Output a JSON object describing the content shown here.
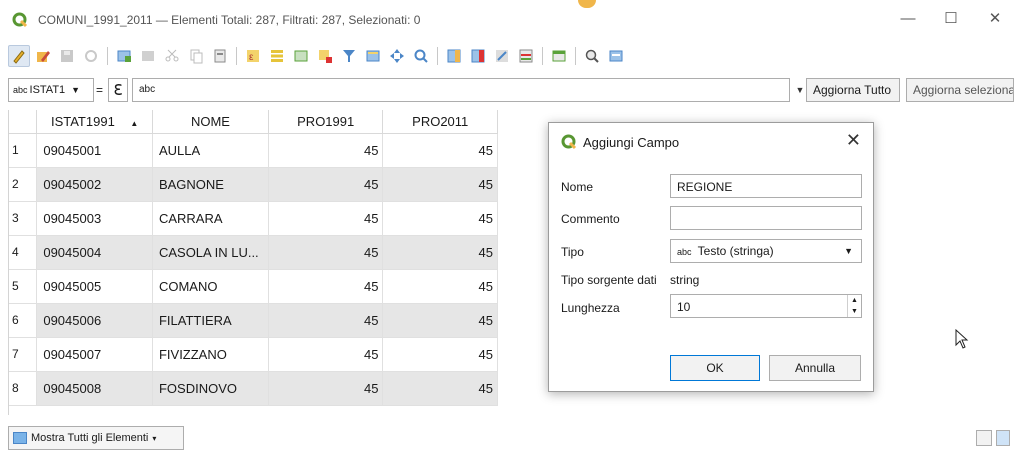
{
  "window": {
    "title": "COMUNI_1991_2011 — Elementi Totali: 287, Filtrati: 287, Selezionati: 0",
    "minimize": "—",
    "maximize": "☐",
    "close": "✕"
  },
  "filter": {
    "field_prefix": "abc",
    "field_name": "ISTAT1",
    "operator": "=",
    "expression_symbol": "ℇ",
    "value": "abc",
    "refresh_label": "Aggiorna Tutto",
    "update_selection_label": "Aggiorna selezionati"
  },
  "table": {
    "columns": [
      "ISTAT1991",
      "NOME",
      "PRO1991",
      "PRO2011"
    ],
    "sort_indicator": "▲",
    "rows": [
      {
        "id": "1",
        "istat": "09045001",
        "nome": "AULLA",
        "pro1991": "45",
        "pro2011": "45"
      },
      {
        "id": "2",
        "istat": "09045002",
        "nome": "BAGNONE",
        "pro1991": "45",
        "pro2011": "45"
      },
      {
        "id": "3",
        "istat": "09045003",
        "nome": "CARRARA",
        "pro1991": "45",
        "pro2011": "45"
      },
      {
        "id": "4",
        "istat": "09045004",
        "nome": "CASOLA IN LU...",
        "pro1991": "45",
        "pro2011": "45"
      },
      {
        "id": "5",
        "istat": "09045005",
        "nome": "COMANO",
        "pro1991": "45",
        "pro2011": "45"
      },
      {
        "id": "6",
        "istat": "09045006",
        "nome": "FILATTIERA",
        "pro1991": "45",
        "pro2011": "45"
      },
      {
        "id": "7",
        "istat": "09045007",
        "nome": "FIVIZZANO",
        "pro1991": "45",
        "pro2011": "45"
      },
      {
        "id": "8",
        "istat": "09045008",
        "nome": "FOSDINOVO",
        "pro1991": "45",
        "pro2011": "45"
      }
    ]
  },
  "dialog": {
    "title": "Aggiungi Campo",
    "close": "✕",
    "nome_label": "Nome",
    "nome_value": "REGIONE",
    "commento_label": "Commento",
    "commento_value": "",
    "tipo_label": "Tipo",
    "tipo_prefix": "abc",
    "tipo_value": "Testo (stringa)",
    "source_type_label": "Tipo sorgente dati",
    "source_type_value": "string",
    "length_label": "Lunghezza",
    "length_value": "10",
    "ok_label": "OK",
    "cancel_label": "Annulla"
  },
  "status": {
    "show_all_label": "Mostra Tutti gli Elementi"
  },
  "colors": {
    "qgis_green": "#589632",
    "qgis_yellow": "#f0b64a",
    "alt_row": "#e6e6e6"
  }
}
